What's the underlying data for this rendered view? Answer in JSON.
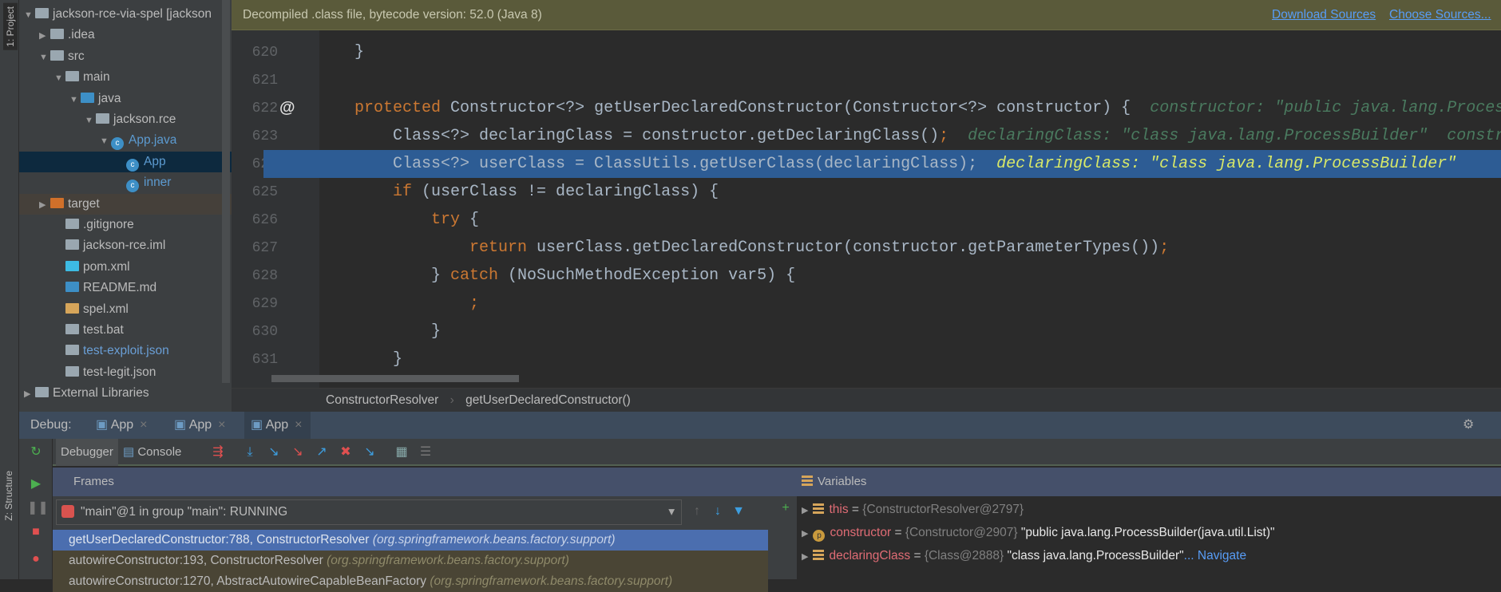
{
  "stripe": {
    "project_label": "1: Project",
    "structure_label": "Z: Structure"
  },
  "tree": [
    {
      "label": "jackson-rce-via-spel [jackson",
      "depth": 0,
      "arrow": "▼",
      "icon": "module-folder-icon",
      "color": "#9aa7b0"
    },
    {
      "label": ".idea",
      "depth": 1,
      "arrow": "▶",
      "icon": "folder-icon",
      "color": "#9aa7b0"
    },
    {
      "label": "src",
      "depth": 1,
      "arrow": "▼",
      "icon": "folder-icon",
      "color": "#9aa7b0"
    },
    {
      "label": "main",
      "depth": 2,
      "arrow": "▼",
      "icon": "folder-icon",
      "color": "#9aa7b0"
    },
    {
      "label": "java",
      "depth": 3,
      "arrow": "▼",
      "icon": "source-folder-icon",
      "color": "#3d8fc6"
    },
    {
      "label": "jackson.rce",
      "depth": 4,
      "arrow": "▼",
      "icon": "package-icon",
      "color": "#9aa7b0"
    },
    {
      "label": "App.java",
      "depth": 5,
      "arrow": "▼",
      "icon": "java-class-icon",
      "color": "#3d8fc6",
      "text_color": "#5c9bd1"
    },
    {
      "label": "App",
      "depth": 6,
      "arrow": "",
      "icon": "java-class-icon",
      "color": "#3d8fc6",
      "text_color": "#5c9bd1",
      "selected": true
    },
    {
      "label": "inner",
      "depth": 6,
      "arrow": "",
      "icon": "java-class-icon",
      "color": "#3d8fc6",
      "text_color": "#5c9bd1"
    },
    {
      "label": "target",
      "depth": 1,
      "arrow": "▶",
      "icon": "excluded-folder-icon",
      "color": "#d0702a",
      "target": true
    },
    {
      "label": ".gitignore",
      "depth": 2,
      "arrow": "",
      "icon": "text-file-icon",
      "color": "#9aa7b0"
    },
    {
      "label": "jackson-rce.iml",
      "depth": 2,
      "arrow": "",
      "icon": "iml-file-icon",
      "color": "#9aa7b0"
    },
    {
      "label": "pom.xml",
      "depth": 2,
      "arrow": "",
      "icon": "maven-icon",
      "color": "#3dbbe3"
    },
    {
      "label": "README.md",
      "depth": 2,
      "arrow": "",
      "icon": "markdown-file-icon",
      "color": "#3d8fc6"
    },
    {
      "label": "spel.xml",
      "depth": 2,
      "arrow": "",
      "icon": "spring-xml-icon",
      "color": "#d6a55a"
    },
    {
      "label": "test.bat",
      "depth": 2,
      "arrow": "",
      "icon": "text-file-icon",
      "color": "#9aa7b0"
    },
    {
      "label": "test-exploit.json",
      "depth": 2,
      "arrow": "",
      "icon": "json-file-icon",
      "color": "#9aa7b0",
      "text_color": "#6a9fd6"
    },
    {
      "label": "test-legit.json",
      "depth": 2,
      "arrow": "",
      "icon": "json-file-icon",
      "color": "#9aa7b0"
    },
    {
      "label": "External Libraries",
      "depth": 0,
      "arrow": "▶",
      "icon": "libraries-icon",
      "color": "#9aa7b0"
    }
  ],
  "banner": {
    "text": "Decompiled .class file, bytecode version: 52.0 (Java 8)",
    "download": "Download Sources",
    "choose": "Choose Sources..."
  },
  "code": [
    {
      "num": "620",
      "tokens": [
        {
          "t": "    }"
        }
      ]
    },
    {
      "num": "621",
      "tokens": []
    },
    {
      "num": "622",
      "marker": "@",
      "tokens": [
        {
          "t": "    "
        },
        {
          "t": "protected",
          "c": "kw"
        },
        {
          "t": " Constructor<?> getUserDeclaredConstructor(Constructor<?> constructor) {  "
        },
        {
          "t": "constructor: \"public java.lang.ProcessBuilder(java.util.List)\"",
          "c": "inl"
        }
      ]
    },
    {
      "num": "623",
      "tokens": [
        {
          "t": "        Class<?> declaringClass = constructor.getDeclaringClass()"
        },
        {
          "t": ";",
          "c": "kw"
        },
        {
          "t": "  "
        },
        {
          "t": "declaringClass: \"class java.lang.ProcessBuilder\"  constructor",
          "c": "inl"
        }
      ]
    },
    {
      "num": "624",
      "highlight": true,
      "tokens": [
        {
          "t": "        Class<?> userClass = ClassUtils.getUserClass(declaringClass);  "
        },
        {
          "t": "declaringClass: \"class java.lang.ProcessBuilder\"",
          "c": "inlh"
        }
      ]
    },
    {
      "num": "625",
      "tokens": [
        {
          "t": "        "
        },
        {
          "t": "if",
          "c": "kw"
        },
        {
          "t": " (userClass != declaringClass) {"
        }
      ]
    },
    {
      "num": "626",
      "tokens": [
        {
          "t": "            "
        },
        {
          "t": "try",
          "c": "kw"
        },
        {
          "t": " {"
        }
      ]
    },
    {
      "num": "627",
      "tokens": [
        {
          "t": "                "
        },
        {
          "t": "return",
          "c": "kw"
        },
        {
          "t": " userClass.getDeclaredConstructor(constructor.getParameterTypes())"
        },
        {
          "t": ";",
          "c": "kw"
        }
      ]
    },
    {
      "num": "628",
      "tokens": [
        {
          "t": "            } "
        },
        {
          "t": "catch",
          "c": "kw"
        },
        {
          "t": " (NoSuchMethodException var5) {"
        }
      ]
    },
    {
      "num": "629",
      "tokens": [
        {
          "t": "                "
        },
        {
          "t": ";",
          "c": "kw"
        }
      ]
    },
    {
      "num": "630",
      "tokens": [
        {
          "t": "            }"
        }
      ]
    },
    {
      "num": "631",
      "tokens": [
        {
          "t": "        }"
        }
      ]
    }
  ],
  "breadcrumb": {
    "class": "ConstructorResolver",
    "method": "getUserDeclaredConstructor()"
  },
  "debug": {
    "label": "Debug:",
    "tabs": [
      "App",
      "App",
      "App"
    ],
    "debugger_tab": "Debugger",
    "console_tab": "Console"
  },
  "frames": {
    "title": "Frames",
    "thread": "\"main\"@1 in group \"main\": RUNNING",
    "items": [
      {
        "method": "getUserDeclaredConstructor:788, ConstructorResolver",
        "pkg": "(org.springframework.beans.factory.support)",
        "selected": true
      },
      {
        "method": "autowireConstructor:193, ConstructorResolver",
        "pkg": "(org.springframework.beans.factory.support)"
      },
      {
        "method": "autowireConstructor:1270, AbstractAutowireCapableBeanFactory",
        "pkg": "(org.springframework.beans.factory.support)"
      }
    ]
  },
  "variables": {
    "title": "Variables",
    "items": [
      {
        "name": "this",
        "ref": "{ConstructorResolver@2797}",
        "value": "",
        "icon": "field-icon"
      },
      {
        "name": "constructor",
        "ref": "{Constructor@2907}",
        "value": "\"public java.lang.ProcessBuilder(java.util.List)\"",
        "icon": "parameter-icon"
      },
      {
        "name": "declaringClass",
        "ref": "{Class@2888}",
        "value": "\"class java.lang.ProcessBuilder\"",
        "nav": "... Navigate",
        "icon": "field-icon"
      }
    ]
  }
}
